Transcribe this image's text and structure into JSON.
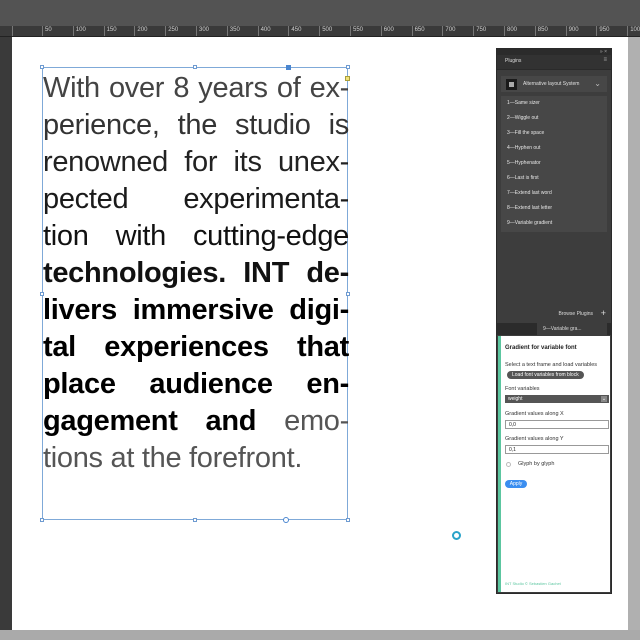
{
  "ruler": {
    "ticks": [
      "50",
      "100",
      "150",
      "200",
      "250",
      "300",
      "350",
      "400",
      "450",
      "500",
      "550",
      "600",
      "650",
      "700",
      "750",
      "800",
      "850",
      "900",
      "950",
      "1000"
    ]
  },
  "text_frame": {
    "lines": [
      "With over 8 years of ex-",
      "perience, the studio is",
      "renowned for its unex-",
      "pected experimenta-",
      "tion with cutting-edge",
      "technologies. INT de-",
      "livers immersive digi-",
      "tal experiences that",
      "place audience en-",
      "gagement and emo-",
      "tions at the forefront."
    ]
  },
  "plugins_panel": {
    "tab_label": "Plugins",
    "menu_icon": "menu-icon",
    "system_select": "Alternative layout System",
    "items": [
      "1—Same sizer",
      "2—Wiggle out",
      "3—Fill the space",
      "4—Hyphen out",
      "5—Hyphenator",
      "6—Last is first",
      "7—Extend last word",
      "8—Extend last letter",
      "9—Variable gradient"
    ],
    "browse_label": "Browse Plugins",
    "subtab_label": "9—Variable gra..."
  },
  "variable_gradient": {
    "title": "Gradient for variable font",
    "hint": "Select a text frame and load variables",
    "load_button": "Load font variables from block",
    "font_variables_label": "Font variables",
    "font_variable_value": "weight",
    "x_label": "Gradient values along X",
    "x_value": "0,0",
    "y_label": "Gradient values along Y",
    "y_value": "0,1",
    "glyph_label": "Glyph by glyph",
    "apply_label": "Apply",
    "footer": "INT Studio © Sebastien Gachet"
  },
  "colors": {
    "accent_green": "#5cc6a0",
    "apply_blue": "#3b8ef0",
    "frame_blue": "#7fa9d8"
  }
}
